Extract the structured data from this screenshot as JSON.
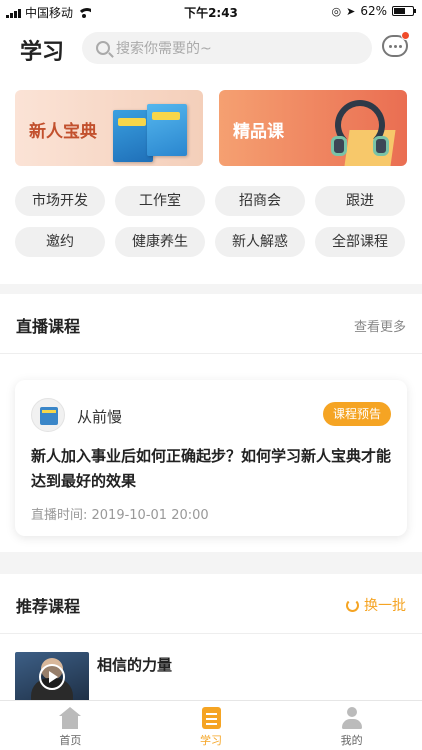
{
  "status_bar": {
    "carrier": "中国移动",
    "time": "下午2:43",
    "battery": "62%",
    "battery_level": 0.62
  },
  "header": {
    "title": "学习",
    "search_placeholder": "搜索你需要的~",
    "message_icon": "message-icon",
    "has_notification": true
  },
  "banners": [
    {
      "label": "新人宝典"
    },
    {
      "label": "精品课"
    }
  ],
  "categories": [
    "市场开发",
    "工作室",
    "招商会",
    "跟进",
    "邀约",
    "健康养生",
    "新人解惑",
    "全部课程"
  ],
  "live": {
    "title": "直播课程",
    "more": "查看更多",
    "card": {
      "host": "从前慢",
      "badge": "课程预告",
      "title": "新人加入事业后如何正确起步？如何学习新人宝典才能达到最好的效果",
      "time": "直播时间: 2019-10-01 20:00"
    }
  },
  "recommend": {
    "title": "推荐课程",
    "refresh": "换一批",
    "courses": [
      {
        "title": "相信的力量"
      }
    ]
  },
  "tabbar": {
    "items": [
      {
        "label": "首页",
        "icon": "home-icon",
        "active": false
      },
      {
        "label": "学习",
        "icon": "study-icon",
        "active": true
      },
      {
        "label": "我的",
        "icon": "me-icon",
        "active": false
      }
    ]
  },
  "colors": {
    "accent": "#f5a423",
    "notification": "#f04b2a"
  }
}
